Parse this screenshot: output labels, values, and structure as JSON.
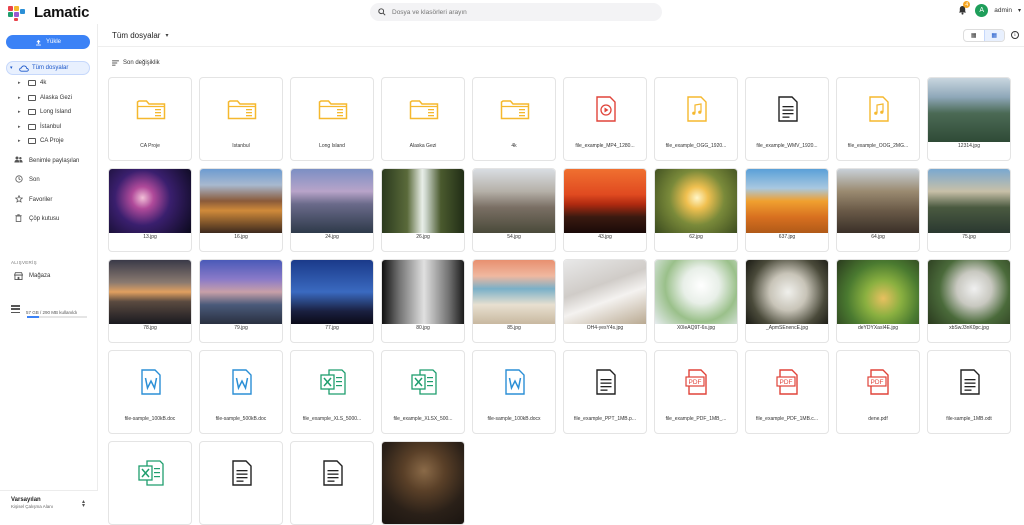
{
  "app": {
    "name": "Lamatic"
  },
  "search": {
    "placeholder": "Dosya ve klasörleri arayın"
  },
  "notifications": {
    "count": "4"
  },
  "user": {
    "initial": "A",
    "name": "admin"
  },
  "sidebar": {
    "upload_label": "Yükle",
    "all_files_label": "Tüm dosyalar",
    "folders": [
      "4k",
      "Alaska Gezi",
      "Long Island",
      "İstanbul",
      "CA Proje"
    ],
    "nav": [
      {
        "label": "Benimle paylaşılan",
        "icon": "people-icon"
      },
      {
        "label": "Son",
        "icon": "clock-icon"
      },
      {
        "label": "Favoriler",
        "icon": "star-icon"
      },
      {
        "label": "Çöp kutusu",
        "icon": "trash-icon"
      }
    ],
    "shopping_section": "ALIŞVERİŞ",
    "store_label": "Mağaza",
    "storage_text": "57 GB / 290 MB kullanıldı",
    "storage_fraction": 0.2,
    "workspace_name": "Varsayılan",
    "workspace_sub": "Kişisel Çalışma Alanı"
  },
  "main": {
    "breadcrumb": "Tüm dosyalar",
    "sort_label": "Son değişiklik"
  },
  "colors": {
    "accent": "#3b82f6",
    "folder": "#f5b82e",
    "word": "#2b8fd6",
    "excel": "#1f9e6e",
    "pdf": "#e0443a"
  },
  "items": [
    {
      "name": "CA Proje",
      "kind": "folder"
    },
    {
      "name": "İstanbul",
      "kind": "folder"
    },
    {
      "name": "Long Island",
      "kind": "folder"
    },
    {
      "name": "Alaska Gezi",
      "kind": "folder"
    },
    {
      "name": "4k",
      "kind": "folder"
    },
    {
      "name": "file_example_MP4_1280...",
      "kind": "video"
    },
    {
      "name": "file_example_OGG_1920...",
      "kind": "audio"
    },
    {
      "name": "file_example_WMV_1920...",
      "kind": "doc"
    },
    {
      "name": "file_example_OOG_2MG...",
      "kind": "audio"
    },
    {
      "name": "12314.jpg",
      "kind": "photo",
      "bg": "linear-gradient(180deg,#c9d6df 0%,#8ea7b8 30%,#4b6a55 55%,#2f4a36 100%)"
    },
    {
      "name": "13.jpg",
      "kind": "photo",
      "bg": "radial-gradient(circle at 40% 45%,#f2c0d8 0%,#b04a9a 18%,#3a1f6e 45%,#080818 100%)"
    },
    {
      "name": "16.jpg",
      "kind": "photo",
      "bg": "linear-gradient(180deg,#6d9bd1 0%,#a8b9cf 25%,#8a5a3a 50%,#d08a3a 65%,#3d2a1e 100%)"
    },
    {
      "name": "24.jpg",
      "kind": "photo",
      "bg": "linear-gradient(180deg,#7c8fc4 0%,#b8a4c9 35%,#6a6a8a 55%,#2e3a4a 100%)"
    },
    {
      "name": "26.jpg",
      "kind": "photo",
      "bg": "linear-gradient(90deg,#2b3a1e 0%,#5a6a3a 30%,#e8eee8 48%,#cfd8cf 52%,#4a5a2e 70%,#1e2a14 100%)"
    },
    {
      "name": "54.jpg",
      "kind": "photo",
      "bg": "linear-gradient(180deg,#d9dde2 0%,#b5b0a8 35%,#7a6f64 60%,#4a4a3a 100%)"
    },
    {
      "name": "43.jpg",
      "kind": "photo",
      "bg": "linear-gradient(180deg,#f07030 0%,#e04a20 40%,#b02a10 55%,#3a1a10 75%,#1a0a08 100%)"
    },
    {
      "name": "62.jpg",
      "kind": "photo",
      "bg": "radial-gradient(circle at 50% 45%,#fff6c8 0%,#f0c050 20%,#7a8a3a 50%,#3a4a1e 100%)"
    },
    {
      "name": "637.jpg",
      "kind": "photo",
      "bg": "linear-gradient(180deg,#5aa0d8 0%,#a8c8e0 30%,#f0a030 50%,#d87020 75%,#b05a18 100%)"
    },
    {
      "name": "64.jpg",
      "kind": "photo",
      "bg": "linear-gradient(180deg,#c8d0d8 0%,#9a8a70 35%,#6a5a48 65%,#3a3028 100%)"
    },
    {
      "name": "75.jpg",
      "kind": "photo",
      "bg": "linear-gradient(180deg,#7aa8d0 0%,#c8c0a8 35%,#4a5a40 60%,#2a3830 100%)"
    },
    {
      "name": "78.jpg",
      "kind": "photo",
      "bg": "linear-gradient(180deg,#3a3a48 0%,#8a7a70 35%,#e0a060 50%,#5a4a40 65%,#1a1a20 100%)"
    },
    {
      "name": "79.jpg",
      "kind": "photo",
      "bg": "linear-gradient(180deg,#4a5ab8 0%,#8a7ac8 30%,#c8a0a8 50%,#4a5a7a 70%,#2a3040 100%)"
    },
    {
      "name": "77.jpg",
      "kind": "photo",
      "bg": "linear-gradient(180deg,#1a3a8a 0%,#3a6ac0 50%,#1a2040 80%,#0a0a18 100%)"
    },
    {
      "name": "80.jpg",
      "kind": "photo",
      "bg": "linear-gradient(90deg,#101010 0%,#707070 20%,#e0e0e0 50%,#707070 80%,#101010 100%)"
    },
    {
      "name": "85.jpg",
      "kind": "photo",
      "bg": "linear-gradient(180deg,#e89070 0%,#f0b8a0 25%,#7ab0c8 45%,#e8e0d0 70%,#c8b8a0 100%)"
    },
    {
      "name": "OH4-yesY4s.jpg",
      "kind": "photo",
      "bg": "linear-gradient(160deg,#e8e8e8 0%,#d0ccc8 40%,#f4f2f0 60%,#b8a890 100%)"
    },
    {
      "name": "X0IeAQ9T-6s.jpg",
      "kind": "photo",
      "bg": "radial-gradient(circle at 55% 40%,#ffffff 0%,#e8efe8 30%,#9ac08a 60%,#e6ecef 100%)"
    },
    {
      "name": "_ApmSEnencE.jpg",
      "kind": "photo",
      "bg": "radial-gradient(circle at 50% 50%,#f0f0ec 0%,#c8c4b8 35%,#4a4a3a 70%,#1a1a14 100%)"
    },
    {
      "name": "deYDYXasI4E.jpg",
      "kind": "photo",
      "bg": "radial-gradient(circle at 55% 60%,#e8c060 0%,#8ab040 30%,#4a7a30 60%,#2a3a1e 100%)"
    },
    {
      "name": "xbSwJ3nK0pc.jpg",
      "kind": "photo",
      "bg": "radial-gradient(circle at 55% 45%,#f0f0f0 0%,#c8c8c0 30%,#4a6a3a 60%,#2a3a1e 100%)"
    },
    {
      "name": "file-sample_100kB.doc",
      "kind": "word"
    },
    {
      "name": "file-sample_500kB.doc",
      "kind": "word"
    },
    {
      "name": "file_example_XLS_5000...",
      "kind": "excel"
    },
    {
      "name": "file_example_XLSX_500...",
      "kind": "excel"
    },
    {
      "name": "file-sample_100kB.docx",
      "kind": "word"
    },
    {
      "name": "file_example_PPT_1MB.p...",
      "kind": "doc"
    },
    {
      "name": "file_example_PDF_1MB_...",
      "kind": "pdf"
    },
    {
      "name": "file_example_PDF_1MB.c...",
      "kind": "pdf"
    },
    {
      "name": "dene.pdf",
      "kind": "pdf"
    },
    {
      "name": "file-sample_1MB.odt",
      "kind": "doc"
    },
    {
      "name": "",
      "kind": "excel"
    },
    {
      "name": "",
      "kind": "doc"
    },
    {
      "name": "",
      "kind": "doc"
    },
    {
      "name": "",
      "kind": "photo",
      "bg": "radial-gradient(circle at 50% 35%,#8a6a48 0%,#5a4028 30%,#2a2018 65%,#1a1410 100%)"
    }
  ]
}
